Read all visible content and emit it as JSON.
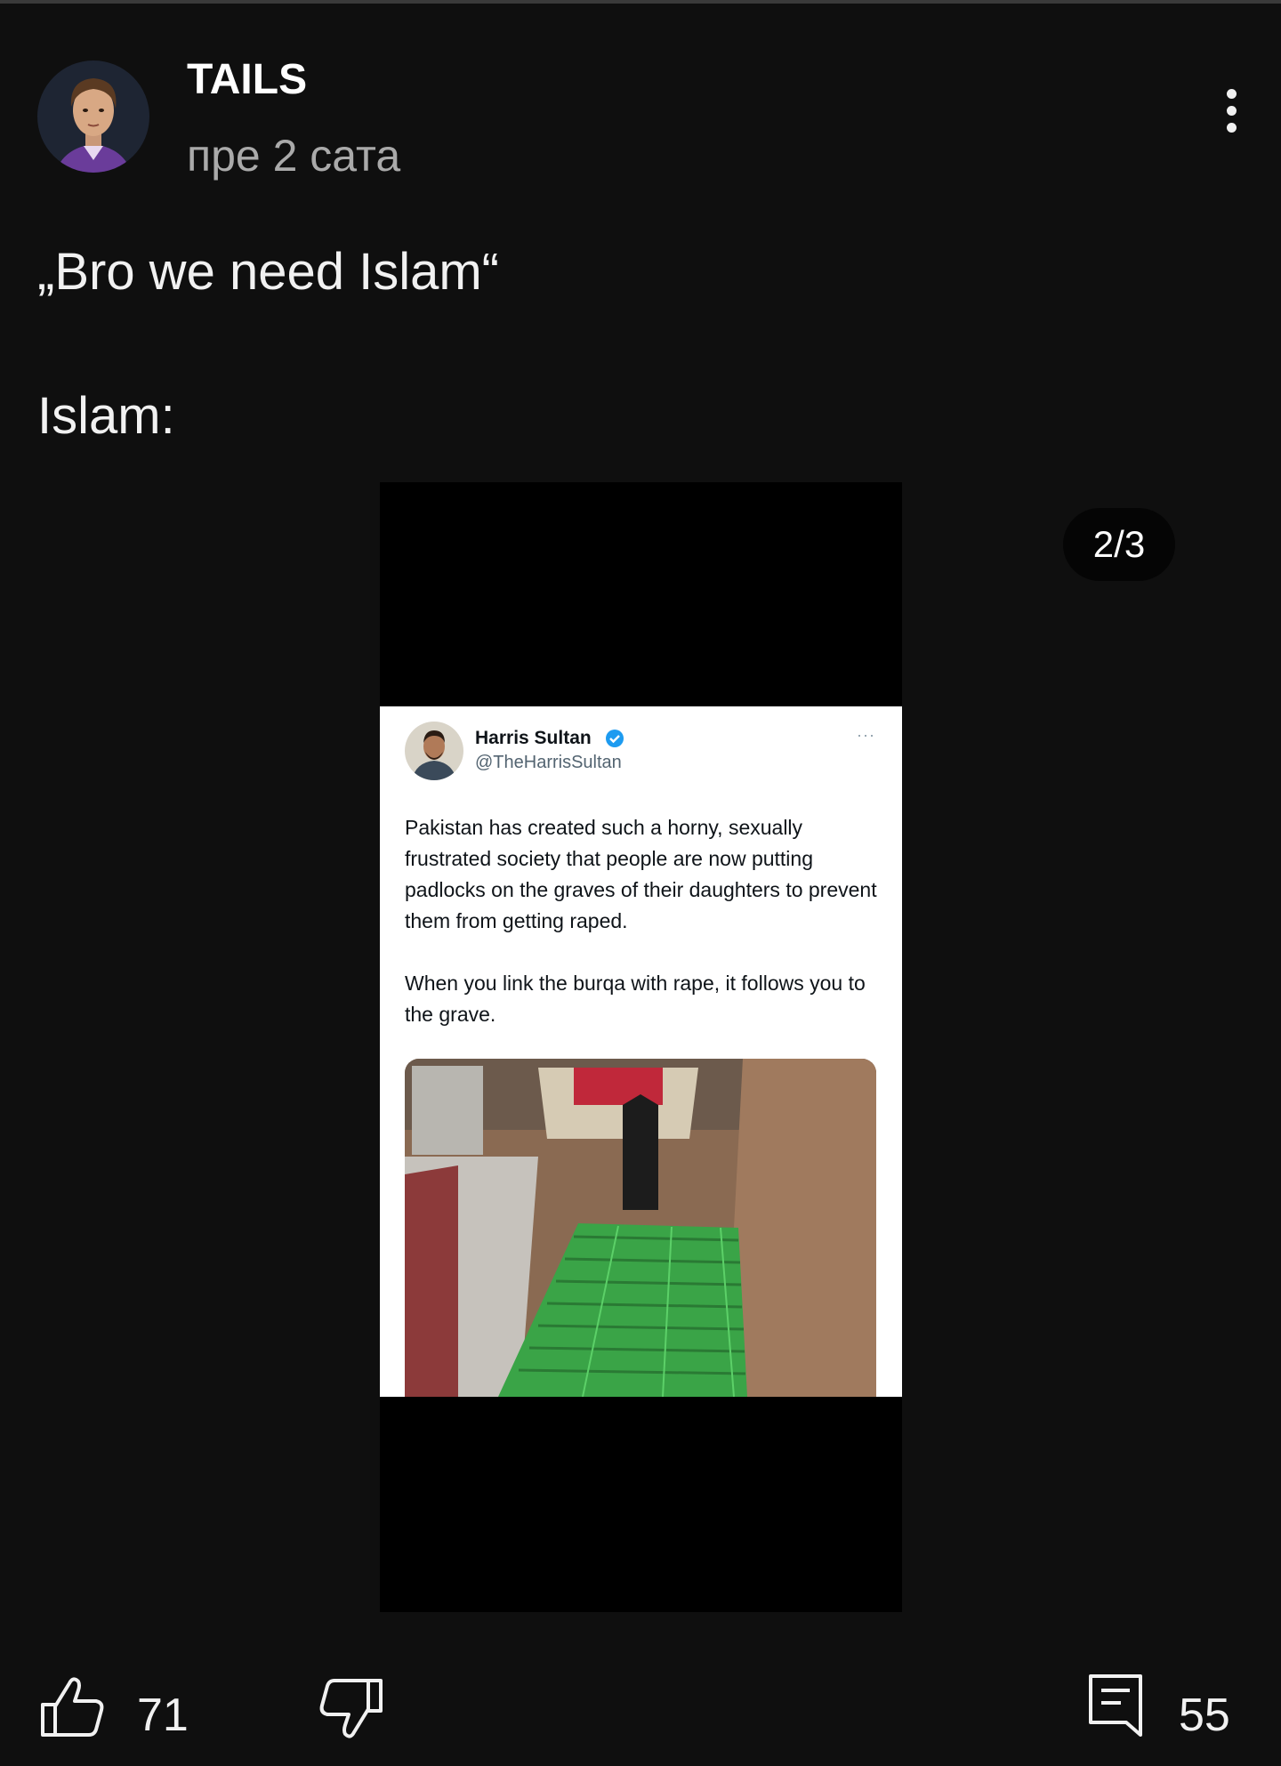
{
  "post": {
    "author": "TAILS",
    "time": "пре 2 сата",
    "text_line1": "„Bro we need Islam“",
    "text_line2": "Islam:",
    "image_counter": "2/3"
  },
  "embedded_tweet": {
    "name": "Harris Sultan",
    "handle": "@TheHarrisSultan",
    "more": "···",
    "paragraph1": "Pakistan has created such a horny, sexually frustrated society that people are now putting padlocks on the graves of their daughters to prevent them from getting raped.",
    "paragraph2": "When you link the burqa with rape, it follows you to the grave."
  },
  "actions": {
    "like_count": "71",
    "comment_count": "55"
  },
  "icons": {
    "more": "more-vert-icon",
    "like": "thumbs-up-icon",
    "dislike": "thumbs-down-icon",
    "comment": "comment-icon",
    "verified": "verified-badge-icon"
  },
  "colors": {
    "background": "#0f0f0f",
    "text": "#f1f1f1",
    "secondary_text": "#aaaaaa",
    "verified_blue": "#1d9bf0",
    "grave_cage_green": "#3fae4a"
  }
}
